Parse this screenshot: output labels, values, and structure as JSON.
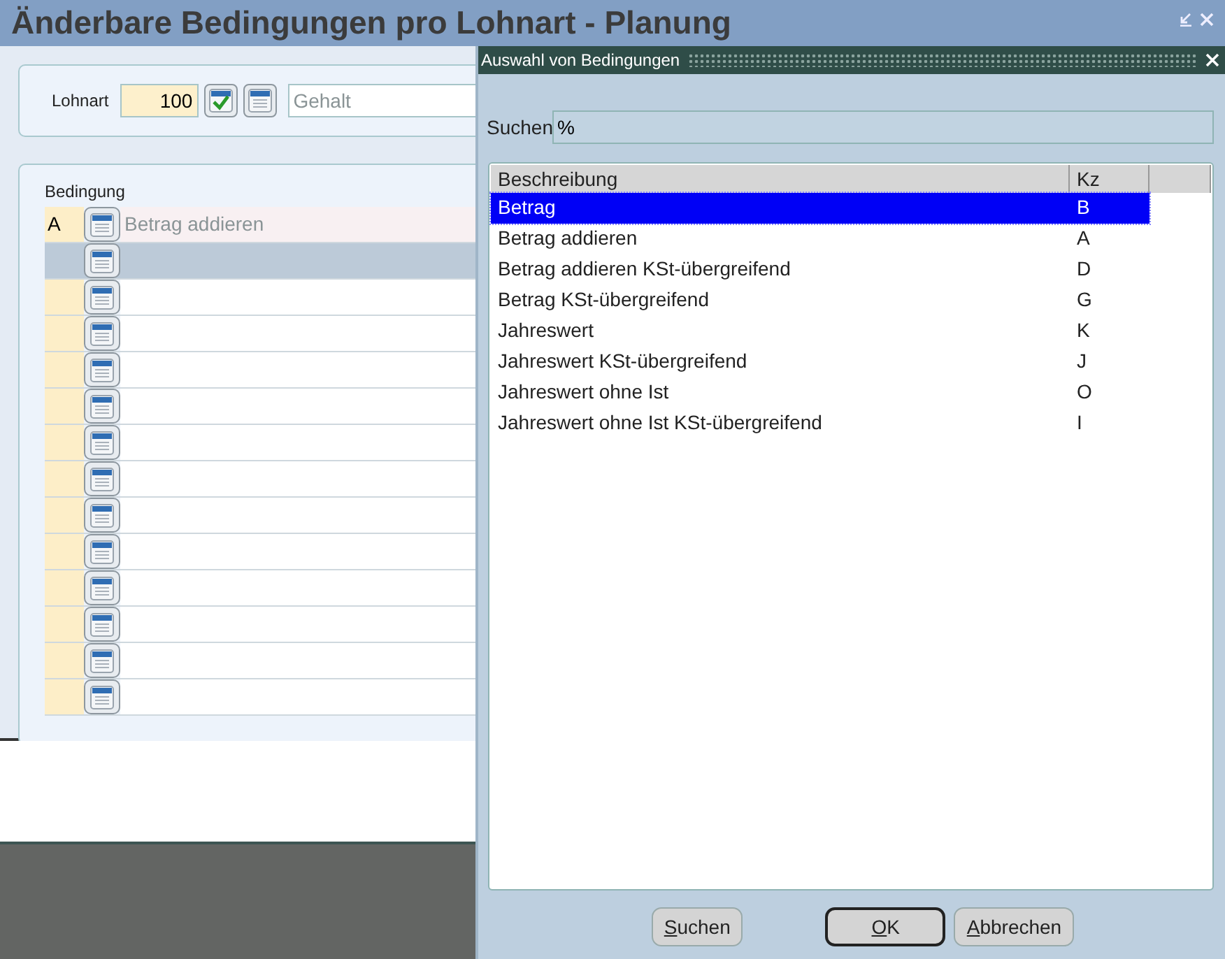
{
  "window": {
    "title": "Änderbare Bedingungen pro Lohnart - Planung"
  },
  "lohnart": {
    "label": "Lohnart",
    "number": "100",
    "name": "Gehalt"
  },
  "bedingungen": {
    "heading": "Bedingung",
    "rows": [
      {
        "code": "A",
        "description": "Betrag addieren",
        "selected": false
      },
      {
        "selected": true
      },
      {
        "selected": false
      },
      {
        "selected": false
      },
      {
        "selected": false
      },
      {
        "selected": false
      },
      {
        "selected": false
      },
      {
        "selected": false
      },
      {
        "selected": false
      },
      {
        "selected": false
      },
      {
        "selected": false
      },
      {
        "selected": false
      },
      {
        "selected": false
      },
      {
        "selected": false
      }
    ]
  },
  "dialog": {
    "title": "Auswahl von Bedingungen",
    "search_label": "Suchen",
    "search_value": "%",
    "columns": [
      "Beschreibung",
      "Kz"
    ],
    "rows": [
      {
        "description": "Betrag",
        "code": "B",
        "selected": true
      },
      {
        "description": "Betrag addieren",
        "code": "A",
        "selected": false
      },
      {
        "description": "Betrag addieren KSt-übergreifend",
        "code": "D",
        "selected": false
      },
      {
        "description": "Betrag KSt-übergreifend",
        "code": "G",
        "selected": false
      },
      {
        "description": "Jahreswert",
        "code": "K",
        "selected": false
      },
      {
        "description": "Jahreswert KSt-übergreifend",
        "code": "J",
        "selected": false
      },
      {
        "description": "Jahreswert ohne Ist",
        "code": "O",
        "selected": false
      },
      {
        "description": "Jahreswert ohne Ist KSt-übergreifend",
        "code": "I",
        "selected": false
      }
    ],
    "buttons": [
      {
        "label": "Suchen",
        "default": false
      },
      {
        "label": "OK",
        "default": true
      },
      {
        "label": "Abbrechen",
        "default": false
      }
    ]
  }
}
